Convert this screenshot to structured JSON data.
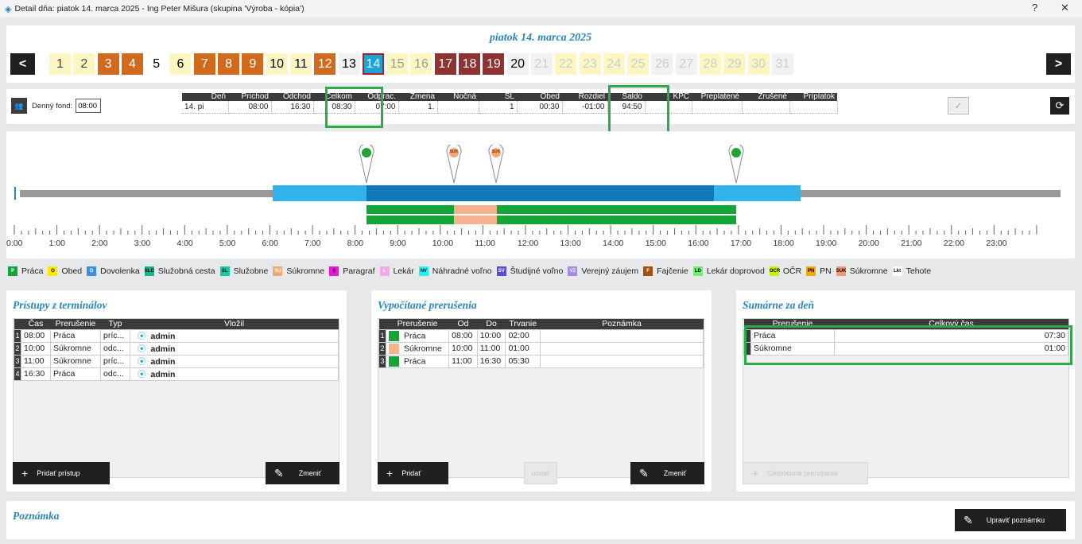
{
  "window": {
    "title": "Detail dňa: piatok 14. marca 2025 - Ing Peter Mišura  (skupina 'Výroba - kópia')",
    "help": "?",
    "close": "✕"
  },
  "date_title": "piatok 14. marca 2025",
  "nav": {
    "prev": "<",
    "next": ">"
  },
  "days": [
    {
      "n": "1",
      "bg": "#fdf6c3",
      "fg": "#444"
    },
    {
      "n": "2",
      "bg": "#fdf6c3",
      "fg": "#444"
    },
    {
      "n": "3",
      "bg": "#d26a1e",
      "fg": "#fff"
    },
    {
      "n": "4",
      "bg": "#d26a1e",
      "fg": "#fff"
    },
    {
      "n": "5",
      "bg": "#fff",
      "fg": "#000"
    },
    {
      "n": "6",
      "bg": "#fdf6c3",
      "fg": "#000"
    },
    {
      "n": "7",
      "bg": "#d26a1e",
      "fg": "#fff"
    },
    {
      "n": "8",
      "bg": "#d26a1e",
      "fg": "#fff"
    },
    {
      "n": "9",
      "bg": "#d26a1e",
      "fg": "#fff"
    },
    {
      "n": "10",
      "bg": "#fdf6c3",
      "fg": "#000"
    },
    {
      "n": "11",
      "bg": "#fdf6c3",
      "fg": "#000"
    },
    {
      "n": "12",
      "bg": "#d26a1e",
      "fg": "#fff"
    },
    {
      "n": "13",
      "bg": "#f1f1f1",
      "fg": "#000"
    },
    {
      "n": "14",
      "bg": "#1ba4d6",
      "fg": "#fff",
      "selected": true
    },
    {
      "n": "15",
      "bg": "#fdf6c3",
      "fg": "#999"
    },
    {
      "n": "16",
      "bg": "#fdf6c3",
      "fg": "#999"
    },
    {
      "n": "17",
      "bg": "#8f3232",
      "fg": "#fff"
    },
    {
      "n": "18",
      "bg": "#8f3232",
      "fg": "#fff"
    },
    {
      "n": "19",
      "bg": "#8f3232",
      "fg": "#fff"
    },
    {
      "n": "20",
      "bg": "#f1f1f1",
      "fg": "#000"
    },
    {
      "n": "21",
      "bg": "#f1f1f1",
      "fg": "#ccc"
    },
    {
      "n": "22",
      "bg": "#fdf6c3",
      "fg": "#ccc"
    },
    {
      "n": "23",
      "bg": "#fdf6c3",
      "fg": "#ccc"
    },
    {
      "n": "24",
      "bg": "#fdf6c3",
      "fg": "#ccc"
    },
    {
      "n": "25",
      "bg": "#fdf6c3",
      "fg": "#ccc"
    },
    {
      "n": "26",
      "bg": "#f1f1f1",
      "fg": "#ccc"
    },
    {
      "n": "27",
      "bg": "#f1f1f1",
      "fg": "#ccc"
    },
    {
      "n": "28",
      "bg": "#fdf6c3",
      "fg": "#ccc"
    },
    {
      "n": "29",
      "bg": "#fdf6c3",
      "fg": "#ccc"
    },
    {
      "n": "30",
      "bg": "#fdf6c3",
      "fg": "#ccc"
    },
    {
      "n": "31",
      "bg": "#f1f1f1",
      "fg": "#ccc"
    }
  ],
  "fond": {
    "label": "Denný fond:",
    "value": "08:00"
  },
  "summary": {
    "headers": [
      "Deň",
      "Príchod",
      "Odchod",
      "Celkom",
      "Odprac.",
      "Zmena",
      "Nočná",
      "SL",
      "Obed",
      "Rozdiel",
      "Saldo",
      "KPČ",
      "Preplatené",
      "Zrušené",
      "Príplatok"
    ],
    "values": [
      "14. pi",
      "08:00",
      "16:30",
      "08:30",
      "07:00",
      "1.",
      "",
      "1",
      "00:30",
      "-01:00",
      "94:50",
      "",
      "",
      "",
      ""
    ]
  },
  "timeline": {
    "hours": [
      "0:00",
      "1:00",
      "2:00",
      "3:00",
      "4:00",
      "5:00",
      "6:00",
      "7:00",
      "8:00",
      "9:00",
      "10:00",
      "11:00",
      "12:00",
      "13:00",
      "14:00",
      "15:00",
      "16:00",
      "17:00",
      "18:00",
      "19:00",
      "20:00",
      "21:00",
      "22:00",
      "23:00"
    ],
    "pins": [
      {
        "label": "",
        "color": "#1fa339"
      },
      {
        "label": "SUK",
        "color": "#f4a675"
      },
      {
        "label": "SUK",
        "color": "#f4a675"
      },
      {
        "label": "",
        "color": "#1fa339"
      }
    ]
  },
  "legend": [
    {
      "code": "P",
      "label": "Práca",
      "bg": "#14a538",
      "fg": "#fff"
    },
    {
      "code": "O",
      "label": "Obed",
      "bg": "#ffe600",
      "fg": "#000"
    },
    {
      "code": "D",
      "label": "Dovolenka",
      "bg": "#3a90dc",
      "fg": "#fff"
    },
    {
      "code": "SLC",
      "label": "Služobná cesta",
      "bg": "#10b88a",
      "fg": "#000"
    },
    {
      "code": "SL",
      "label": "Služobne",
      "bg": "#17c7a0",
      "fg": "#000"
    },
    {
      "code": "SU",
      "label": "Súkromne",
      "bg": "#f6a76e",
      "fg": "#fff"
    },
    {
      "code": "§",
      "label": "Paragraf",
      "bg": "#ee16d6",
      "fg": "#000"
    },
    {
      "code": "L",
      "label": "Lekár",
      "bg": "#f7a8e8",
      "fg": "#fff"
    },
    {
      "code": "NV",
      "label": "Náhradné voľno",
      "bg": "#22f2f8",
      "fg": "#000"
    },
    {
      "code": "SV",
      "label": "Študijné voľno",
      "bg": "#5a50d8",
      "fg": "#fff"
    },
    {
      "code": "VZ",
      "label": "Verejný záujem",
      "bg": "#a58ae8",
      "fg": "#fff"
    },
    {
      "code": "F",
      "label": "Fajčenie",
      "bg": "#a5500e",
      "fg": "#fff"
    },
    {
      "code": "LD",
      "label": "Lekár doprovod",
      "bg": "#6ff06e",
      "fg": "#000"
    },
    {
      "code": "OCR",
      "label": "OČR",
      "bg": "#c8f10f",
      "fg": "#000"
    },
    {
      "code": "PN",
      "label": "PN",
      "bg": "#f8a410",
      "fg": "#000"
    },
    {
      "code": "SUK",
      "label": "Súkromne",
      "bg": "#f39a70",
      "fg": "#000"
    },
    {
      "code": "Lkt",
      "label": "Tehote",
      "bg": "#fff",
      "fg": "#000"
    }
  ],
  "pristupy": {
    "title": "Prístupy z terminálov",
    "headers": [
      "Čas",
      "Prerušenie",
      "Typ",
      "Vložil"
    ],
    "rows": [
      {
        "n": "1",
        "cas": "08:00",
        "prer": "Práca",
        "typ": "príc...",
        "vlozil": "admin"
      },
      {
        "n": "2",
        "cas": "10:00",
        "prer": "Súkromne",
        "typ": "odc...",
        "vlozil": "admin"
      },
      {
        "n": "3",
        "cas": "11:00",
        "prer": "Súkromne",
        "typ": "príc...",
        "vlozil": "admin"
      },
      {
        "n": "4",
        "cas": "16:30",
        "prer": "Práca",
        "typ": "odc...",
        "vlozil": "admin"
      }
    ],
    "add": "Pridať prístup",
    "edit": "Zmeniť"
  },
  "vypocitane": {
    "title": "Vypočítané prerušenia",
    "headers": [
      "Prerušenie",
      "Od",
      "Do",
      "Trvanie",
      "Poznámka"
    ],
    "rows": [
      {
        "n": "1",
        "prer": "Práca",
        "color": "#14a538",
        "od": "08:00",
        "do": "10:00",
        "trv": "02:00"
      },
      {
        "n": "2",
        "prer": "Súkromne",
        "color": "#f6b28e",
        "od": "10:00",
        "do": "11:00",
        "trv": "01:00"
      },
      {
        "n": "3",
        "prer": "Práca",
        "color": "#14a538",
        "od": "11:00",
        "do": "16:30",
        "trv": "05:30"
      }
    ],
    "add": "Pridať",
    "approve": "uznať",
    "edit": "Zmeniť"
  },
  "sumarne": {
    "title": "Sumárne za deň",
    "headers": [
      "Prerušenie",
      "Celkový čas"
    ],
    "rows": [
      {
        "prer": "Práca",
        "cas": "07:30"
      },
      {
        "prer": "Súkromne",
        "cas": "01:00"
      }
    ],
    "btn": "Celodenné prerušenie"
  },
  "poznamka": {
    "title": "Poznámka",
    "btn": "Upraviť poznámku"
  }
}
